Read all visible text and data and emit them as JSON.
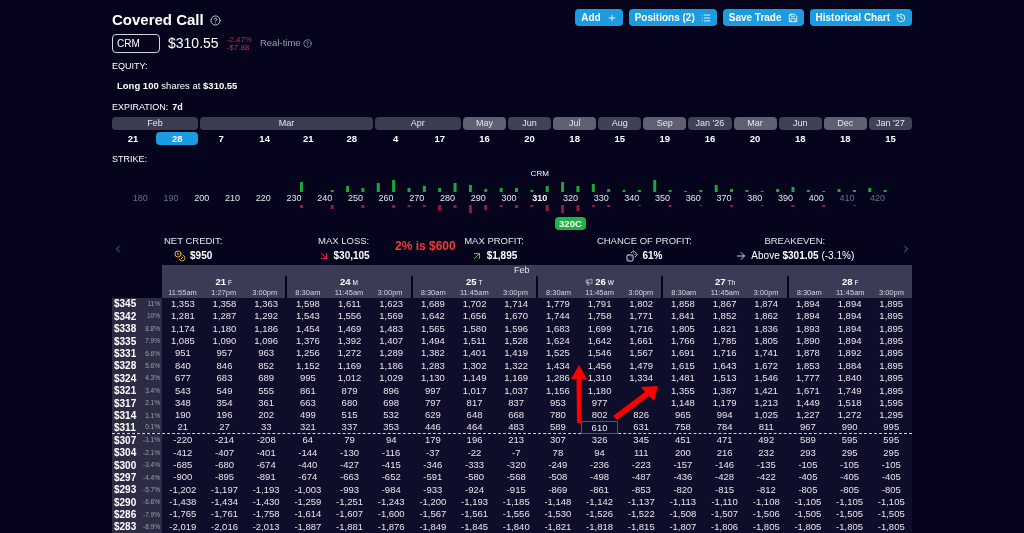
{
  "title": "Covered Call",
  "actions": [
    {
      "label": "Add",
      "kind": "add"
    },
    {
      "label": "Positions (2)",
      "kind": "list"
    },
    {
      "label": "Save Trade",
      "kind": "save"
    },
    {
      "label": "Historical Chart",
      "kind": "history"
    }
  ],
  "ticker": {
    "value": "CRM",
    "price": "$310.55",
    "change_pct": "-2.47%",
    "change_abs": "-$7.88",
    "feed": "Real-time"
  },
  "equity": {
    "label": "EQUITY:",
    "text": "**Long 100** shares at **$310.55**"
  },
  "expiration": {
    "label": "EXPIRATION:",
    "value": "7d",
    "months": [
      {
        "label": "Feb",
        "dates": [
          {
            "label": "21",
            "selected": false
          },
          {
            "label": "28",
            "selected": true
          }
        ]
      },
      {
        "label": "Mar",
        "dates": [
          {
            "label": "7",
            "selected": false
          },
          {
            "label": "14",
            "selected": false
          },
          {
            "label": "21",
            "selected": false
          },
          {
            "label": "28",
            "selected": false
          }
        ]
      },
      {
        "label": "Apr",
        "dates": [
          {
            "label": "4",
            "selected": false
          },
          {
            "label": "17",
            "selected": false
          }
        ]
      },
      {
        "label": "May",
        "dates": [
          {
            "label": "16",
            "selected": false
          }
        ]
      },
      {
        "label": "Jun",
        "dates": [
          {
            "label": "20",
            "selected": false
          }
        ]
      },
      {
        "label": "Jul",
        "dates": [
          {
            "label": "18",
            "selected": false
          }
        ]
      },
      {
        "label": "Aug",
        "dates": [
          {
            "label": "15",
            "selected": false
          }
        ]
      },
      {
        "label": "Sep",
        "dates": [
          {
            "label": "19",
            "selected": false
          }
        ]
      },
      {
        "label": "Jan '26",
        "dates": [
          {
            "label": "16",
            "selected": false
          }
        ]
      },
      {
        "label": "Mar",
        "dates": [
          {
            "label": "20",
            "selected": false
          }
        ]
      },
      {
        "label": "Jun",
        "dates": [
          {
            "label": "18",
            "selected": false
          }
        ]
      },
      {
        "label": "Dec",
        "dates": [
          {
            "label": "18",
            "selected": false
          }
        ]
      },
      {
        "label": "Jan '27",
        "dates": [
          {
            "label": "15",
            "selected": false
          }
        ]
      }
    ]
  },
  "strike": {
    "label": "STRIKE:",
    "price_label": "CRM",
    "selected_label": "320C",
    "ticks": [
      {
        "label": "180",
        "faded": true,
        "at_price": false,
        "selected": false
      },
      {
        "label": "190",
        "faded": true,
        "at_price": false,
        "selected": false
      },
      {
        "label": "200",
        "faded": false,
        "at_price": false,
        "selected": false
      },
      {
        "label": "210",
        "faded": false,
        "at_price": false,
        "selected": false
      },
      {
        "label": "220",
        "faded": false,
        "at_price": false,
        "selected": false
      },
      {
        "label": "230",
        "faded": false,
        "at_price": false,
        "selected": false
      },
      {
        "label": "240",
        "faded": false,
        "at_price": false,
        "selected": false
      },
      {
        "label": "250",
        "faded": false,
        "at_price": false,
        "selected": false
      },
      {
        "label": "260",
        "faded": false,
        "at_price": false,
        "selected": false
      },
      {
        "label": "270",
        "faded": false,
        "at_price": false,
        "selected": false
      },
      {
        "label": "280",
        "faded": false,
        "at_price": false,
        "selected": false
      },
      {
        "label": "290",
        "faded": false,
        "at_price": false,
        "selected": false
      },
      {
        "label": "300",
        "faded": false,
        "at_price": false,
        "selected": false
      },
      {
        "label": "310",
        "faded": false,
        "at_price": true,
        "selected": false
      },
      {
        "label": "320",
        "faded": false,
        "at_price": false,
        "selected": true
      },
      {
        "label": "330",
        "faded": false,
        "at_price": false,
        "selected": false
      },
      {
        "label": "340",
        "faded": false,
        "at_price": false,
        "selected": false
      },
      {
        "label": "350",
        "faded": false,
        "at_price": false,
        "selected": false
      },
      {
        "label": "360",
        "faded": false,
        "at_price": false,
        "selected": false
      },
      {
        "label": "370",
        "faded": false,
        "at_price": false,
        "selected": false
      },
      {
        "label": "380",
        "faded": false,
        "at_price": false,
        "selected": false
      },
      {
        "label": "390",
        "faded": false,
        "at_price": false,
        "selected": false
      },
      {
        "label": "400",
        "faded": false,
        "at_price": false,
        "selected": false
      },
      {
        "label": "410",
        "faded": true,
        "at_price": false,
        "selected": false
      },
      {
        "label": "420",
        "faded": true,
        "at_price": false,
        "selected": false
      }
    ]
  },
  "stats": [
    {
      "kind": "credit",
      "label": "NET CREDIT:",
      "value": "$950"
    },
    {
      "kind": "loss",
      "label": "MAX LOSS:",
      "value": "$30,105"
    },
    {
      "kind": "profit",
      "label": "MAX PROFIT:",
      "value": "$1,895"
    },
    {
      "kind": "chance",
      "label": "CHANCE OF PROFIT:",
      "value": "61%"
    },
    {
      "kind": "breakeven",
      "label": "BREAKEVEN:",
      "value": "Above **$301.05** (-3.1%)"
    }
  ],
  "note": "2% is $600",
  "table": {
    "month": "Feb",
    "days": [
      {
        "day": "21",
        "weekday": "F",
        "event": false,
        "times": [
          "11:55am",
          "1:27pm",
          "3:00pm"
        ]
      },
      {
        "day": "24",
        "weekday": "M",
        "event": false,
        "times": [
          "8:30am",
          "11:45am",
          "3:00pm"
        ]
      },
      {
        "day": "25",
        "weekday": "T",
        "event": false,
        "times": [
          "8:30am",
          "11:45am",
          "3:00pm"
        ]
      },
      {
        "day": "26",
        "weekday": "W",
        "event": true,
        "times": [
          "8:30am",
          "11:45am",
          "3:00pm"
        ]
      },
      {
        "day": "27",
        "weekday": "Th",
        "event": false,
        "times": [
          "8:30am",
          "11:45am",
          "3:00pm"
        ]
      },
      {
        "day": "28",
        "weekday": "F",
        "event": false,
        "times": [
          "8:30am",
          "11:45am",
          "3:00pm"
        ]
      }
    ],
    "rows": [
      {
        "strike": "$345",
        "pct": "11%",
        "at_price": false,
        "cells": [
          "1,353",
          "1,358",
          "1,363",
          "1,598",
          "1,611",
          "1,623",
          "1,689",
          "1,702",
          "1,714",
          "1,779",
          "1,791",
          "1,802",
          "1,858",
          "1,867",
          "1,874",
          "1,894",
          "1,894",
          "1,895"
        ]
      },
      {
        "strike": "$342",
        "pct": "10%",
        "at_price": false,
        "cells": [
          "1,281",
          "1,287",
          "1,292",
          "1,543",
          "1,556",
          "1,569",
          "1,642",
          "1,656",
          "1,670",
          "1,744",
          "1,758",
          "1,771",
          "1,841",
          "1,852",
          "1,862",
          "1,894",
          "1,894",
          "1,895"
        ]
      },
      {
        "strike": "$338",
        "pct": "8.8%",
        "at_price": false,
        "cells": [
          "1,174",
          "1,180",
          "1,186",
          "1,454",
          "1,469",
          "1,483",
          "1,565",
          "1,580",
          "1,596",
          "1,683",
          "1,699",
          "1,716",
          "1,805",
          "1,821",
          "1,836",
          "1,893",
          "1,894",
          "1,895"
        ]
      },
      {
        "strike": "$335",
        "pct": "7.9%",
        "at_price": false,
        "cells": [
          "1,085",
          "1,090",
          "1,096",
          "1,376",
          "1,392",
          "1,407",
          "1,494",
          "1,511",
          "1,528",
          "1,624",
          "1,642",
          "1,661",
          "1,766",
          "1,785",
          "1,805",
          "1,890",
          "1,894",
          "1,895"
        ]
      },
      {
        "strike": "$331",
        "pct": "6.6%",
        "at_price": false,
        "cells": [
          "951",
          "957",
          "963",
          "1,256",
          "1,272",
          "1,289",
          "1,382",
          "1,401",
          "1,419",
          "1,525",
          "1,546",
          "1,567",
          "1,691",
          "1,716",
          "1,741",
          "1,878",
          "1,892",
          "1,895"
        ]
      },
      {
        "strike": "$328",
        "pct": "5.6%",
        "at_price": false,
        "cells": [
          "840",
          "846",
          "852",
          "1,152",
          "1,169",
          "1,186",
          "1,283",
          "1,302",
          "1,322",
          "1,434",
          "1,456",
          "1,479",
          "1,615",
          "1,643",
          "1,672",
          "1,853",
          "1,884",
          "1,895"
        ]
      },
      {
        "strike": "$324",
        "pct": "4.3%",
        "at_price": false,
        "cells": [
          "677",
          "683",
          "689",
          "995",
          "1,012",
          "1,029",
          "1,130",
          "1,149",
          "1,169",
          "1,286",
          "1,310",
          "1,334",
          "1,481",
          "1,513",
          "1,546",
          "1,777",
          "1,840",
          "1,895"
        ]
      },
      {
        "strike": "$321",
        "pct": "3.4%",
        "at_price": false,
        "cells": [
          "543",
          "549",
          "555",
          "861",
          "879",
          "896",
          "997",
          "1,017",
          "1,037",
          "1,156",
          "1,180",
          null,
          "1,355",
          "1,387",
          "1,421",
          "1,671",
          "1,749",
          "1,895"
        ]
      },
      {
        "strike": "$317",
        "pct": "2.1%",
        "at_price": false,
        "cells": [
          "348",
          "354",
          "361",
          "663",
          "680",
          "698",
          "797",
          "817",
          "837",
          "953",
          "977",
          null,
          "1,148",
          "1,179",
          "1,213",
          "1,449",
          "1,518",
          "1,595"
        ]
      },
      {
        "strike": "$314",
        "pct": "1.1%",
        "at_price": false,
        "cells": [
          "190",
          "196",
          "202",
          "499",
          "515",
          "532",
          "629",
          "648",
          "668",
          "780",
          "802",
          "826",
          "965",
          "994",
          "1,025",
          "1,227",
          "1,272",
          "1,295"
        ]
      },
      {
        "strike": "$311",
        "pct": "0.1%",
        "at_price": true,
        "cells": [
          "21",
          "27",
          "33",
          "321",
          "337",
          "353",
          "446",
          "464",
          "483",
          "589",
          {
            "value": "610",
            "boxed": true
          },
          "631",
          "758",
          "784",
          "811",
          "967",
          "990",
          "995"
        ]
      },
      {
        "strike": "$307",
        "pct": "-1.1%",
        "at_price": false,
        "cells": [
          "-220",
          "-214",
          "-208",
          "64",
          "79",
          "94",
          "179",
          "196",
          "213",
          "307",
          "326",
          "345",
          "451",
          "471",
          "492",
          "589",
          "595",
          "595"
        ]
      },
      {
        "strike": "$304",
        "pct": "-2.1%",
        "at_price": false,
        "cells": [
          "-412",
          "-407",
          "-401",
          "-144",
          "-130",
          "-116",
          "-37",
          "-22",
          "-7",
          "78",
          "94",
          "111",
          "200",
          "216",
          "232",
          "293",
          "295",
          "295"
        ]
      },
      {
        "strike": "$300",
        "pct": "-3.4%",
        "at_price": false,
        "cells": [
          "-685",
          "-680",
          "-674",
          "-440",
          "-427",
          "-415",
          "-346",
          "-333",
          "-320",
          "-249",
          "-236",
          "-223",
          "-157",
          "-146",
          "-135",
          "-105",
          "-105",
          "-105"
        ]
      },
      {
        "strike": "$297",
        "pct": "-4.4%",
        "at_price": false,
        "cells": [
          "-900",
          "-895",
          "-891",
          "-674",
          "-663",
          "-652",
          "-591",
          "-580",
          "-568",
          "-508",
          "-498",
          "-487",
          "-436",
          "-428",
          "-422",
          "-405",
          "-405",
          "-405"
        ]
      },
      {
        "strike": "$293",
        "pct": "-5.7%",
        "at_price": false,
        "cells": [
          "-1,202",
          "-1,197",
          "-1,193",
          "-1,003",
          "-993",
          "-984",
          "-933",
          "-924",
          "-915",
          "-869",
          "-861",
          "-853",
          "-820",
          "-815",
          "-812",
          "-805",
          "-805",
          "-805"
        ]
      },
      {
        "strike": "$290",
        "pct": "-6.6%",
        "at_price": false,
        "cells": [
          "-1,438",
          "-1,434",
          "-1,430",
          "-1,259",
          "-1,251",
          "-1,243",
          "-1,200",
          "-1,193",
          "-1,185",
          "-1,148",
          "-1,142",
          "-1,137",
          "-1,113",
          "-1,110",
          "-1,108",
          "-1,105",
          "-1,105",
          "-1,105"
        ]
      },
      {
        "strike": "$286",
        "pct": "-7.9%",
        "at_price": false,
        "cells": [
          "-1,765",
          "-1,761",
          "-1,758",
          "-1,614",
          "-1,607",
          "-1,600",
          "-1,567",
          "-1,561",
          "-1,556",
          "-1,530",
          "-1,526",
          "-1,522",
          "-1,508",
          "-1,507",
          "-1,506",
          "-1,505",
          "-1,505",
          "-1,505"
        ]
      },
      {
        "strike": "$283",
        "pct": "-8.9%",
        "at_price": false,
        "cells": [
          "-2,019",
          "-2,016",
          "-2,013",
          "-1,887",
          "-1,881",
          "-1,876",
          "-1,849",
          "-1,845",
          "-1,840",
          "-1,821",
          "-1,818",
          "-1,815",
          "-1,807",
          "-1,806",
          "-1,805",
          "-1,805",
          "-1,805",
          "-1,805"
        ]
      }
    ]
  }
}
